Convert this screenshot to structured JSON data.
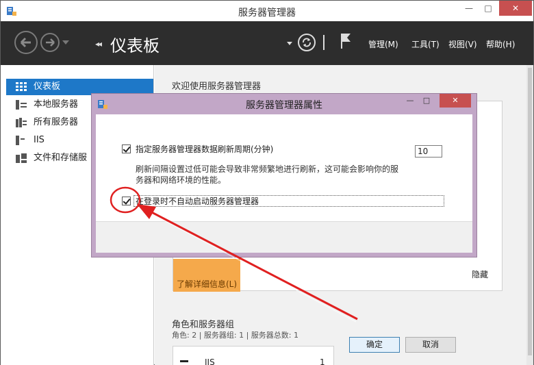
{
  "window": {
    "title": "服务器管理器",
    "controls": {
      "minimize": "—",
      "maximize": "□",
      "close": "✕"
    }
  },
  "header": {
    "breadcrumb_arrows": "◂◂",
    "title": "仪表板",
    "menus": [
      {
        "label": "管理(M)"
      },
      {
        "label": "工具(T)"
      },
      {
        "label": "视图(V)"
      },
      {
        "label": "帮助(H)"
      }
    ]
  },
  "sidebar": {
    "items": [
      {
        "label": "仪表板",
        "active": true,
        "icon": "dashboard-grid-icon"
      },
      {
        "label": "本地服务器",
        "active": false,
        "icon": "server-icon"
      },
      {
        "label": "所有服务器",
        "active": false,
        "icon": "servers-icon"
      },
      {
        "label": "IIS",
        "active": false,
        "icon": "iis-server-icon"
      },
      {
        "label": "文件和存储服",
        "active": false,
        "icon": "storage-icon"
      }
    ]
  },
  "main": {
    "welcome_title": "欢迎使用服务器管理器",
    "learn_more": "了解详细信息(L)",
    "hide": "隐藏",
    "roles_title": "角色和服务器组",
    "roles_summary": "角色: 2 | 服务器组: 1 | 服务器总数: 1",
    "tile": {
      "name": "IIS",
      "count": "1"
    }
  },
  "dialog": {
    "title": "服务器管理器属性",
    "controls": {
      "minimize": "—",
      "maximize": "□",
      "close": "✕"
    },
    "refresh_option": {
      "label": "指定服务器管理器数据刷新周期(分钟)",
      "checked": true,
      "value": "10"
    },
    "description": "刷新间隔设置过低可能会导致非常频繁地进行刷新，这可能会影响你的服务器和网络环境的性能。",
    "startup_option": {
      "label": "在登录时不自动启动服务器管理器",
      "checked": true
    },
    "ok_label": "确定",
    "cancel_label": "取消"
  },
  "colors": {
    "header_bg": "#2d2d2d",
    "sidebar_active": "#1e78c8",
    "dialog_frame": "#c2a7c7",
    "learn_more_bg": "#f5a94b",
    "annotation_red": "#e02020"
  }
}
